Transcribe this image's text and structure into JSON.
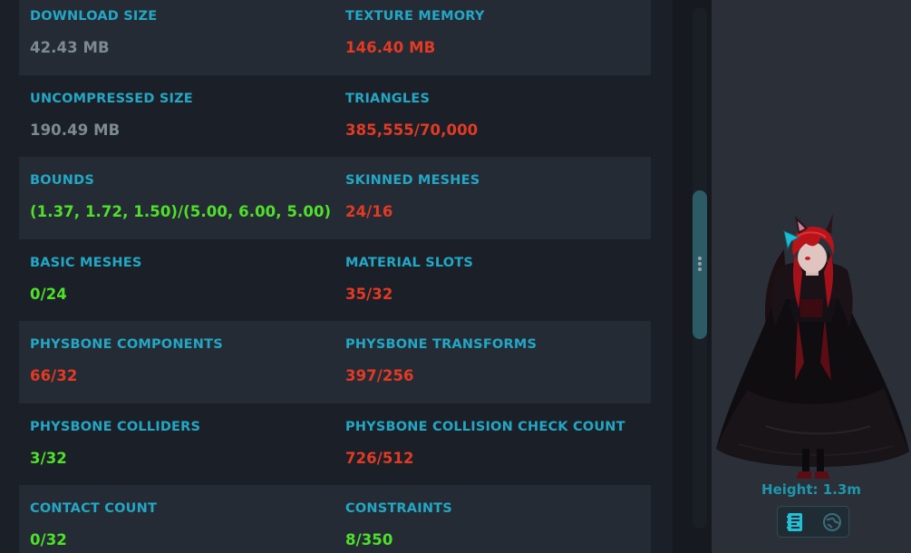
{
  "stats": [
    {
      "label": "DOWNLOAD SIZE",
      "value": "42.43 MB",
      "status": "neutral"
    },
    {
      "label": "TEXTURE MEMORY",
      "value": "146.40 MB",
      "status": "bad"
    },
    {
      "label": "UNCOMPRESSED SIZE",
      "value": "190.49 MB",
      "status": "neutral"
    },
    {
      "label": "TRIANGLES",
      "value": "385,555/70,000",
      "status": "bad"
    },
    {
      "label": "BOUNDS",
      "value": "(1.37, 1.72, 1.50)/(5.00, 6.00, 5.00)",
      "status": "good"
    },
    {
      "label": "SKINNED MESHES",
      "value": "24/16",
      "status": "bad"
    },
    {
      "label": "BASIC MESHES",
      "value": "0/24",
      "status": "good"
    },
    {
      "label": "MATERIAL SLOTS",
      "value": "35/32",
      "status": "bad"
    },
    {
      "label": "PHYSBONE COMPONENTS",
      "value": "66/32",
      "status": "bad"
    },
    {
      "label": "PHYSBONE TRANSFORMS",
      "value": "397/256",
      "status": "bad"
    },
    {
      "label": "PHYSBONE COLLIDERS",
      "value": "3/32",
      "status": "good"
    },
    {
      "label": "PHYSBONE COLLISION CHECK COUNT",
      "value": "726/512",
      "status": "bad"
    },
    {
      "label": "CONTACT COUNT",
      "value": "0/32",
      "status": "good"
    },
    {
      "label": "CONSTRAINTS",
      "value": "8/350",
      "status": "good"
    }
  ],
  "preview": {
    "height_label": "Height: 1.3m",
    "toggle_buttons": [
      {
        "icon": "stats-icon",
        "active": true
      },
      {
        "icon": "globe-icon",
        "active": false
      }
    ]
  },
  "colors": {
    "label": "#22a7c4",
    "neutral": "#7d8a92",
    "bad": "#e33a24",
    "good": "#4fe02a",
    "accent": "#1d97ad"
  }
}
